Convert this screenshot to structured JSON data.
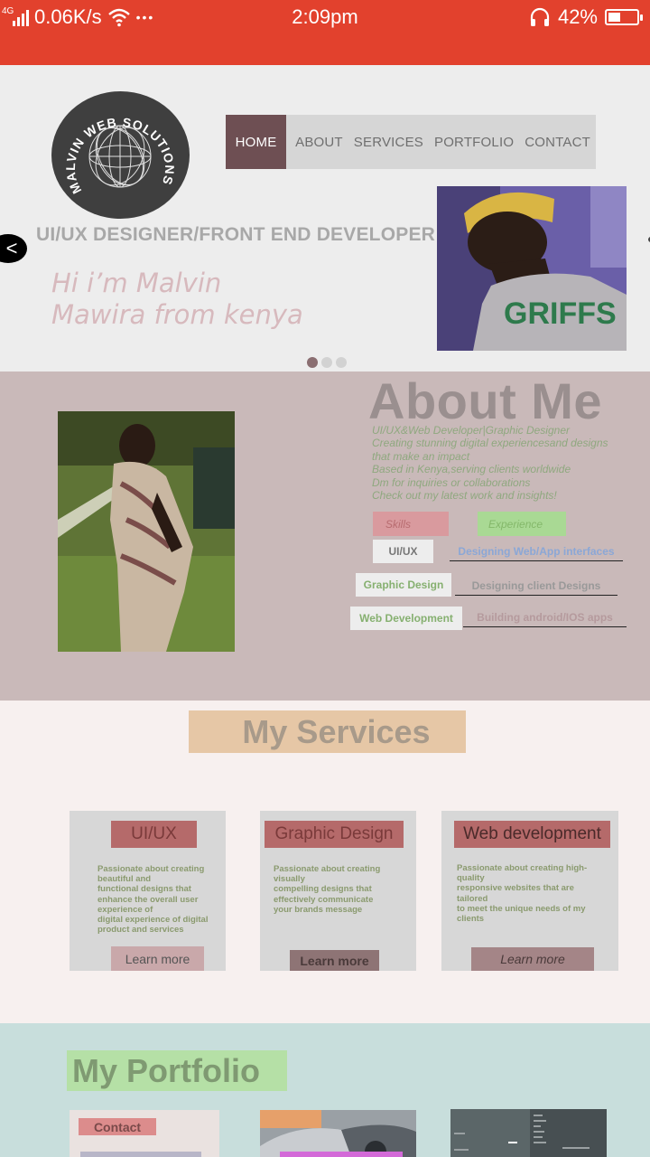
{
  "status_bar": {
    "network_type": "4G",
    "speed": "0.06K/s",
    "more": "•••",
    "time": "2:09pm",
    "battery": "42%",
    "battery_level": 0.42
  },
  "hero": {
    "logo_text": "MALVIN WEB SOLUTIONS",
    "nav": [
      "HOME",
      "ABOUT",
      "SERVICES",
      "PORTFOLIO",
      "CONTACT"
    ],
    "title": "UI/UX DESIGNER/FRONT END DEVELOPER",
    "greeting_line1": "Hi i’m Malvin",
    "greeting_line2": "Mawira from kenya",
    "prev_label": "<",
    "slide_count": 3,
    "active_slide": 1
  },
  "about": {
    "title": "About Me",
    "lines": [
      "UI/UX&Web Developer|Graphic Designer",
      "Creating stunning digital experiencesand designs",
      "that make an impact",
      "Based in Kenya,serving clients worldwide",
      "Dm for inquiries or collaborations",
      "Check out my latest work and insights!"
    ],
    "skills_label": "Skills",
    "experience_label": "Experience",
    "skills": [
      "UI/UX",
      "Graphic Design",
      "Web Development"
    ],
    "experience": [
      "Designing Web/App interfaces",
      "Designing client Designs",
      "Building android/IOS apps"
    ]
  },
  "services": {
    "title": "My Services",
    "cards": [
      {
        "title": "UI/UX",
        "desc": "Passionate about creating\nbeautiful and\n functional designs that\nenhance the overall user\nexperience of\ndigital experience of digital\nproduct and services",
        "button": "Learn more"
      },
      {
        "title": "Graphic Design",
        "desc": "Passionate about creating\nvisually\ncompelling designs that\neffectively communicate\nyour brands message",
        "button": "Learn more"
      },
      {
        "title": "Web development",
        "desc": "Passionate about creating high-\nquality\nresponsive websites that are\ntailored\nto meet the unique needs of my\nclients",
        "button": "Learn more"
      }
    ]
  },
  "portfolio": {
    "title": "My Portfolio",
    "card1_label": "Contact"
  },
  "colors": {
    "status_bar": "#e2412d",
    "nav_active": "#6e4f53",
    "about_bg": "#c9b9b9",
    "services_bg": "#f7f0ef",
    "portfolio_bg": "#c8dedc"
  }
}
